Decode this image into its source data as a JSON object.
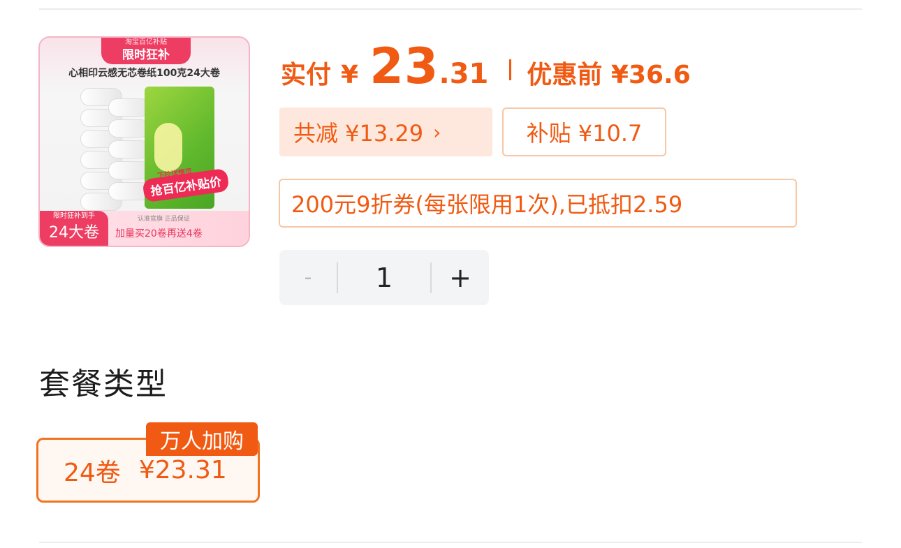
{
  "thumbnail": {
    "banner_small": "淘宝百亿补贴",
    "banner_big": "限时狂补",
    "product_title": "心相印云感无芯卷纸100克24大卷",
    "promo_small": "下拉详情页",
    "promo_big": "抢百亿补贴价",
    "corner_small": "限时狂补到手",
    "corner_big": "24大卷",
    "bottom_small": "认准官旗 正品保证",
    "bottom_text": "加量买20卷再送4卷"
  },
  "price": {
    "label": "实付",
    "currency": "¥",
    "integer": "23",
    "decimal": ".31",
    "original": "优惠前 ¥36.6"
  },
  "discounts": {
    "reduce": "共减 ¥13.29",
    "reduce_chevron": "›",
    "subsidy": "补贴 ¥10.7",
    "coupon": "200元9折券(每张限用1次),已抵扣2.59"
  },
  "quantity": {
    "minus": "-",
    "value": "1",
    "plus": "+"
  },
  "package": {
    "section_title": "套餐类型",
    "option_size": "24卷",
    "option_price": "¥23.31",
    "badge": "万人加购"
  },
  "colors": {
    "accent": "#f05a12",
    "chip_bg": "#fee8de",
    "chip_border": "#f7c7a6",
    "brand_pink": "#ee3d62"
  }
}
